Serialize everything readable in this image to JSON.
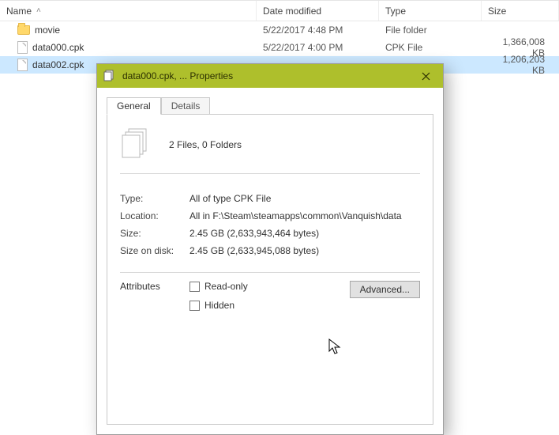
{
  "explorer": {
    "columns": {
      "name": "Name",
      "date": "Date modified",
      "type": "Type",
      "size": "Size"
    },
    "rows": [
      {
        "icon": "folder",
        "name": "movie",
        "date": "5/22/2017 4:48 PM",
        "type": "File folder",
        "size": "",
        "selected": false
      },
      {
        "icon": "file",
        "name": "data000.cpk",
        "date": "5/22/2017 4:00 PM",
        "type": "CPK File",
        "size": "1,366,008 KB",
        "selected": false
      },
      {
        "icon": "file",
        "name": "data002.cpk",
        "date": "",
        "type": "",
        "size": "1,206,203 KB",
        "selected": true
      }
    ]
  },
  "dialog": {
    "title": "data000.cpk, ... Properties",
    "tabs": {
      "general": "General",
      "details": "Details"
    },
    "summary": "2 Files, 0 Folders",
    "fields": {
      "type_label": "Type:",
      "type_value": "All of type CPK File",
      "location_label": "Location:",
      "location_value": "All in F:\\Steam\\steamapps\\common\\Vanquish\\data",
      "size_label": "Size:",
      "size_value": "2.45 GB (2,633,943,464 bytes)",
      "sod_label": "Size on disk:",
      "sod_value": "2.45 GB (2,633,945,088 bytes)"
    },
    "attributes_label": "Attributes",
    "readonly_label": "Read-only",
    "hidden_label": "Hidden",
    "advanced_label": "Advanced..."
  }
}
